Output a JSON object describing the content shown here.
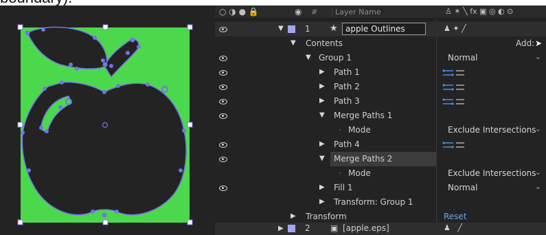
{
  "top_text": "boundary).",
  "header": {
    "switch_icons_left": "○ ◑ ● 🔒",
    "tag_icon": "tag-icon",
    "hash": "#",
    "layer_name_label": "Layer Name",
    "switch_icons_right": "♙ ✴ ╲ fx ▣ ◎ ◐ ⊙"
  },
  "layer1": {
    "number": "1",
    "name": "apple Outlines",
    "star": "★",
    "label_color": "#a4a6f2"
  },
  "rows": {
    "contents": "Contents",
    "add_label": "Add:",
    "group1": "Group 1",
    "group1_mode": "Normal",
    "path1": "Path 1",
    "path2": "Path 2",
    "path3": "Path 3",
    "merge1": "Merge Paths 1",
    "merge1_mode_label": "Mode",
    "merge1_mode": "Exclude Intersections",
    "path4": "Path 4",
    "merge2": "Merge Paths 2",
    "merge2_mode_label": "Mode",
    "merge2_mode": "Exclude Intersections",
    "fill1": "Fill 1",
    "fill1_mode": "Normal",
    "transform_group": "Transform: Group 1",
    "transform": "Transform",
    "reset": "Reset"
  },
  "layer2": {
    "number": "2",
    "name": "[apple.eps]",
    "label_color": "#a4a6f2"
  },
  "colors": {
    "shape_fill": "#4cd84c",
    "path_stroke": "#6f76e6",
    "panel_bg": "#232323",
    "accent_link": "#6fa4e8"
  }
}
